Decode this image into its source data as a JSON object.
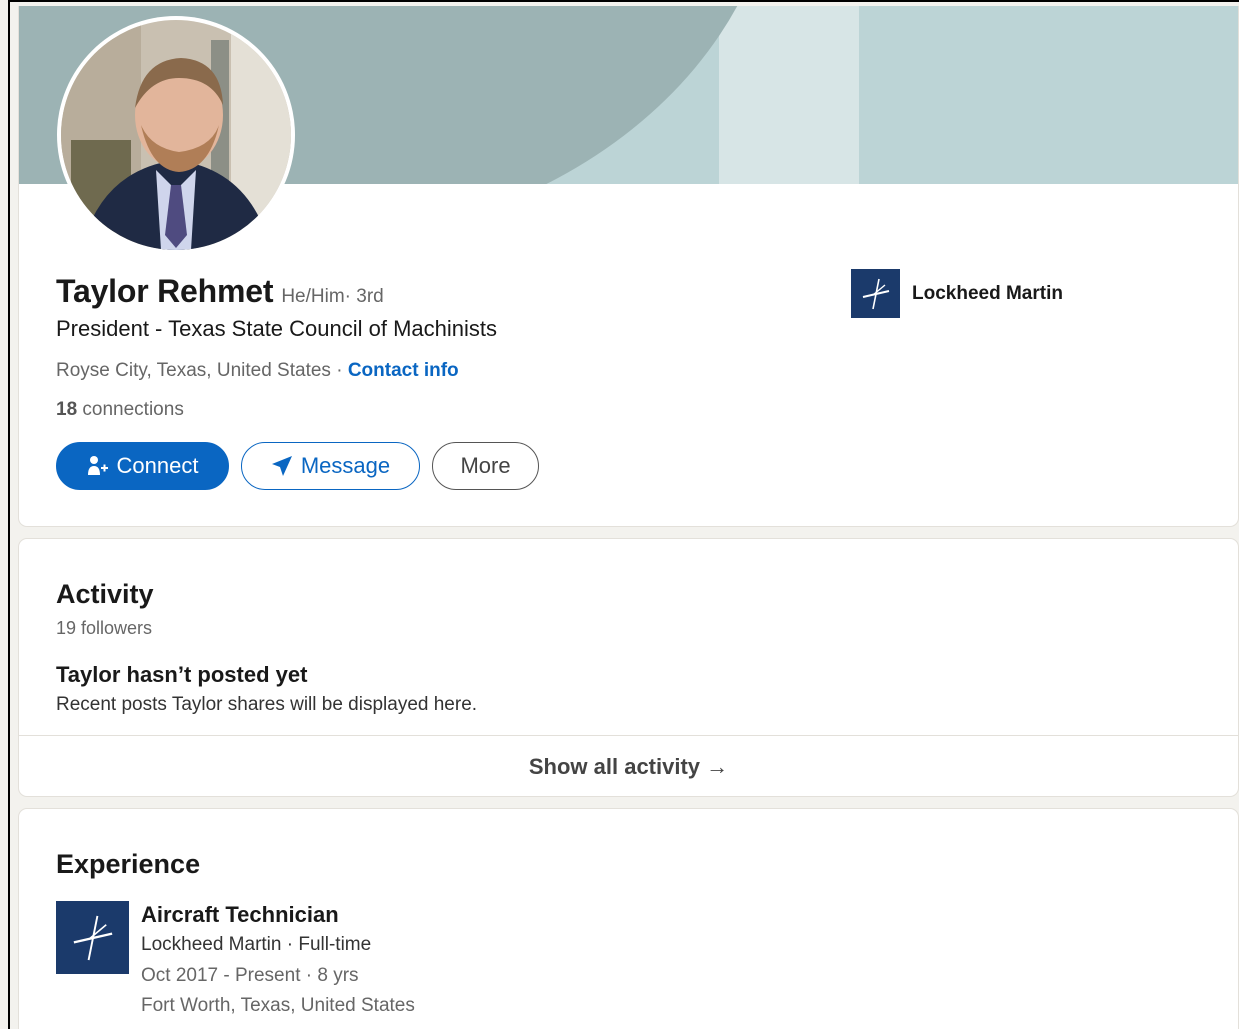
{
  "profile": {
    "name": "Taylor Rehmet",
    "pronouns": "He/Him",
    "degree": " · 3rd",
    "headline": "President - Texas State Council of Machinists",
    "location": "Royse City, Texas, United States",
    "location_sep": " · ",
    "contact_info": "Contact info",
    "connections_count": "18",
    "connections_label": " connections",
    "company": "Lockheed Martin",
    "buttons": {
      "connect": "Connect",
      "message": "Message",
      "more": "More"
    },
    "colors": {
      "brand_blue": "#0a66c2",
      "cover_dark": "#9cb3b4",
      "cover_light": "#bcd4d6",
      "company_logo": "#1b3a6b"
    },
    "icons": [
      "connect-person-plus-icon",
      "message-send-icon",
      "lockheed-star-logo"
    ]
  },
  "activity": {
    "title": "Activity",
    "followers": "19 followers",
    "empty_title": "Taylor hasn’t posted yet",
    "empty_sub": "Recent posts Taylor shares will be displayed here.",
    "show_all": "Show all activity →"
  },
  "experience": {
    "title": "Experience",
    "items": [
      {
        "title": "Aircraft Technician",
        "company": "Lockheed Martin · Full-time",
        "dates": "Oct 2017 - Present · 8 yrs",
        "location": "Fort Worth, Texas, United States"
      }
    ]
  }
}
